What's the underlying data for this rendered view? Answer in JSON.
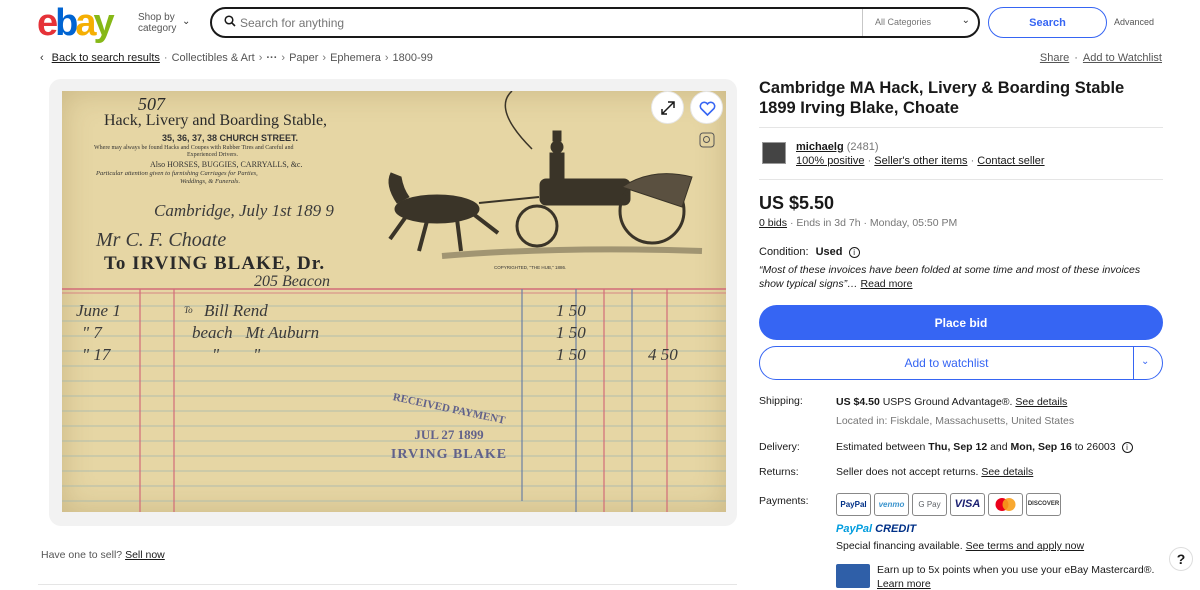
{
  "header": {
    "logo_letters": [
      "e",
      "b",
      "a",
      "y"
    ],
    "shop_by_label": "Shop by",
    "shop_by_label2": "category",
    "search_placeholder": "Search for anything",
    "category_selected": "All Categories",
    "search_button": "Search",
    "advanced_link": "Advanced"
  },
  "breadcrumb": {
    "back": "Back to search results",
    "items": [
      "Collectibles & Art",
      "Paper",
      "Ephemera",
      "1800-99"
    ],
    "more": "···"
  },
  "top_links": {
    "share": "Share",
    "add_watchlist": "Add to Watchlist"
  },
  "listing": {
    "title": "Cambridge MA Hack, Livery & Boarding Stable 1899 Irving Blake, Choate",
    "seller": {
      "name": "michaelg",
      "feedback": "(2481)",
      "positive": "100% positive",
      "other_items": "Seller's other items",
      "contact": "Contact seller"
    },
    "price": "US $5.50",
    "bids_link": "0 bids",
    "ends": "· Ends in 3d 7h · Monday, 05:50 PM",
    "condition_label": "Condition:",
    "condition_value": "Used",
    "condition_desc": "“Most of these invoices have been folded at some time and most of these invoices show typical signs”…",
    "read_more": "Read more",
    "place_bid": "Place bid",
    "add_to_watchlist": "Add to watchlist"
  },
  "details": {
    "shipping_label": "Shipping:",
    "shipping_price": "US $4.50",
    "shipping_service": "USPS Ground Advantage®.",
    "shipping_details": "See details",
    "located": "Located in: Fiskdale, Massachusetts, United States",
    "delivery_label": "Delivery:",
    "delivery_prefix": "Estimated between",
    "delivery_start": "Thu, Sep 12",
    "delivery_and": "and",
    "delivery_end": "Mon, Sep 16",
    "delivery_to": "to 26003",
    "returns_label": "Returns:",
    "returns_text": "Seller does not accept returns.",
    "returns_details": "See details",
    "payments_label": "Payments:",
    "payment_methods": [
      "PayPal",
      "venmo",
      "G Pay",
      "VISA",
      "",
      "DISCOVER"
    ],
    "paypal_credit_a": "PayPal",
    "paypal_credit_b": "CREDIT",
    "financing_text": "Special financing available.",
    "financing_link": "See terms and apply now",
    "card_text": "Earn up to 5x points when you use your eBay Mastercard®.",
    "learn_more": "Learn more"
  },
  "sell": {
    "prompt": "Have one to sell?",
    "link": "Sell now"
  },
  "invoice": {
    "number": "507",
    "business": "Hack, Livery and Boarding Stable,",
    "address": "35, 36, 37, 38 CHURCH STREET.",
    "line1": "Where may always be found Hacks and Coupes with Rubber Tires and Careful and",
    "line2": "Experienced Drivers.",
    "line3": "Also HORSES, BUGGIES, CARRYALLS, &c.",
    "line4": "Particular attention given to furnishing Carriages for Parties,",
    "line5": "Weddings, & Funerals.",
    "date": "Cambridge, July 1st 189 9",
    "customer": "Mr C. F. Choate",
    "to_line": "To IRVING BLAKE, Dr.",
    "street": "205 Beacon",
    "rows": [
      {
        "d": "June 1",
        "to": "To",
        "item": "Bill Rend",
        "amt": "1 50",
        "tot": ""
      },
      {
        "d": "\" 7",
        "to": "",
        "item": "beach   Mt Auburn",
        "amt": "1 50",
        "tot": ""
      },
      {
        "d": "\" 17",
        "to": "",
        "item": "\"        \"",
        "amt": "1 50",
        "tot": "4 50"
      }
    ],
    "stamp1": "RECEIVED PAYMENT",
    "stamp2": "JUL 27 1899",
    "stamp3": "IRVING BLAKE",
    "copyright": "COPYRIGHTED, \"THE HUB,\" 1886."
  },
  "colors": {
    "accent": "#3665f3",
    "logo_e": "#e53238",
    "logo_b": "#0064d2",
    "logo_a": "#f5af02",
    "logo_y": "#86b817",
    "paper": "#e6d6a4"
  }
}
